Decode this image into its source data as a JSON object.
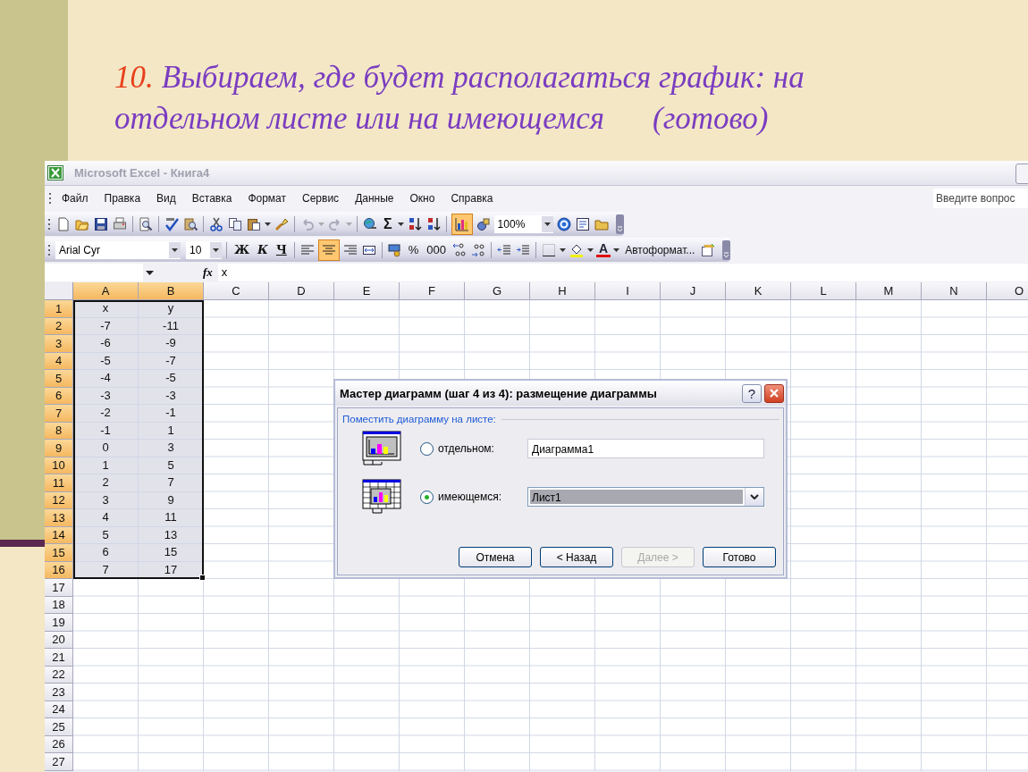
{
  "slide": {
    "number": "10.",
    "title_lines": [
      "Выбираем, где будет располагаться график: на",
      "отдельном листе или на имеющемся"
    ],
    "note": "(готово)"
  },
  "window": {
    "title": "Microsoft Excel - Книга4"
  },
  "menu": [
    "Файл",
    "Правка",
    "Вид",
    "Вставка",
    "Формат",
    "Сервис",
    "Данные",
    "Окно",
    "Справка"
  ],
  "help_box": {
    "placeholder": "Введите вопрос"
  },
  "standard_toolbar": {
    "sum": "Σ",
    "chart_wizard_on": true,
    "zoom": "100%"
  },
  "formatting_toolbar": {
    "font": "Arial Cyr",
    "size": "10",
    "bold": "Ж",
    "italic": "К",
    "underline": "Ч",
    "align_center_on": true,
    "percent": "%",
    "thousands": "000",
    "font_color": "A",
    "autoformat": "Автоформат..."
  },
  "formula_bar": {
    "fx": "fx",
    "value": "x"
  },
  "sheet": {
    "columns": [
      {
        "label": "A",
        "selected": true
      },
      {
        "label": "B",
        "selected": true
      },
      {
        "label": "C",
        "selected": false
      },
      {
        "label": "D",
        "selected": false
      },
      {
        "label": "E",
        "selected": false
      },
      {
        "label": "F",
        "selected": false
      },
      {
        "label": "G",
        "selected": false
      },
      {
        "label": "H",
        "selected": false
      },
      {
        "label": "I",
        "selected": false
      },
      {
        "label": "J",
        "selected": false
      },
      {
        "label": "K",
        "selected": false
      },
      {
        "label": "L",
        "selected": false
      },
      {
        "label": "M",
        "selected": false
      },
      {
        "label": "N",
        "selected": false
      },
      {
        "label": "O",
        "selected": false
      }
    ],
    "rows": [
      {
        "number": "1",
        "selected": true,
        "cells": [
          "x",
          "y"
        ]
      },
      {
        "number": "2",
        "selected": true,
        "cells": [
          "-7",
          "-11"
        ]
      },
      {
        "number": "3",
        "selected": true,
        "cells": [
          "-6",
          "-9"
        ]
      },
      {
        "number": "4",
        "selected": true,
        "cells": [
          "-5",
          "-7"
        ]
      },
      {
        "number": "5",
        "selected": true,
        "cells": [
          "-4",
          "-5"
        ]
      },
      {
        "number": "6",
        "selected": true,
        "cells": [
          "-3",
          "-3"
        ]
      },
      {
        "number": "7",
        "selected": true,
        "cells": [
          "-2",
          "-1"
        ]
      },
      {
        "number": "8",
        "selected": true,
        "cells": [
          "-1",
          "1"
        ]
      },
      {
        "number": "9",
        "selected": true,
        "cells": [
          "0",
          "3"
        ]
      },
      {
        "number": "10",
        "selected": true,
        "cells": [
          "1",
          "5"
        ]
      },
      {
        "number": "11",
        "selected": true,
        "cells": [
          "2",
          "7"
        ]
      },
      {
        "number": "12",
        "selected": true,
        "cells": [
          "3",
          "9"
        ]
      },
      {
        "number": "13",
        "selected": true,
        "cells": [
          "4",
          "11"
        ]
      },
      {
        "number": "14",
        "selected": true,
        "cells": [
          "5",
          "13"
        ]
      },
      {
        "number": "15",
        "selected": true,
        "cells": [
          "6",
          "15"
        ]
      },
      {
        "number": "16",
        "selected": true,
        "cells": [
          "7",
          "17"
        ]
      },
      {
        "number": "17",
        "selected": false
      },
      {
        "number": "18",
        "selected": false
      },
      {
        "number": "19",
        "selected": false
      },
      {
        "number": "20",
        "selected": false
      },
      {
        "number": "21",
        "selected": false
      },
      {
        "number": "22",
        "selected": false
      },
      {
        "number": "23",
        "selected": false
      },
      {
        "number": "24",
        "selected": false
      },
      {
        "number": "25",
        "selected": false
      },
      {
        "number": "26",
        "selected": false
      },
      {
        "number": "27",
        "selected": false
      }
    ]
  },
  "dialog": {
    "title": "Мастер диаграмм (шаг 4 из 4): размещение диаграммы",
    "help": "?",
    "group_label": "Поместить диаграмму на листе:",
    "options": [
      {
        "kind": "text",
        "label": "отдельном:",
        "selected": false,
        "value": "Диаграмма1"
      },
      {
        "kind": "dropdown",
        "label": "имеющемся:",
        "selected": true,
        "value": "Лист1"
      }
    ],
    "buttons": [
      {
        "label": "Отмена",
        "disabled": false
      },
      {
        "label": "< Назад",
        "disabled": false
      },
      {
        "label": "Далее >",
        "disabled": true
      },
      {
        "label": "Готово",
        "disabled": false
      }
    ]
  }
}
